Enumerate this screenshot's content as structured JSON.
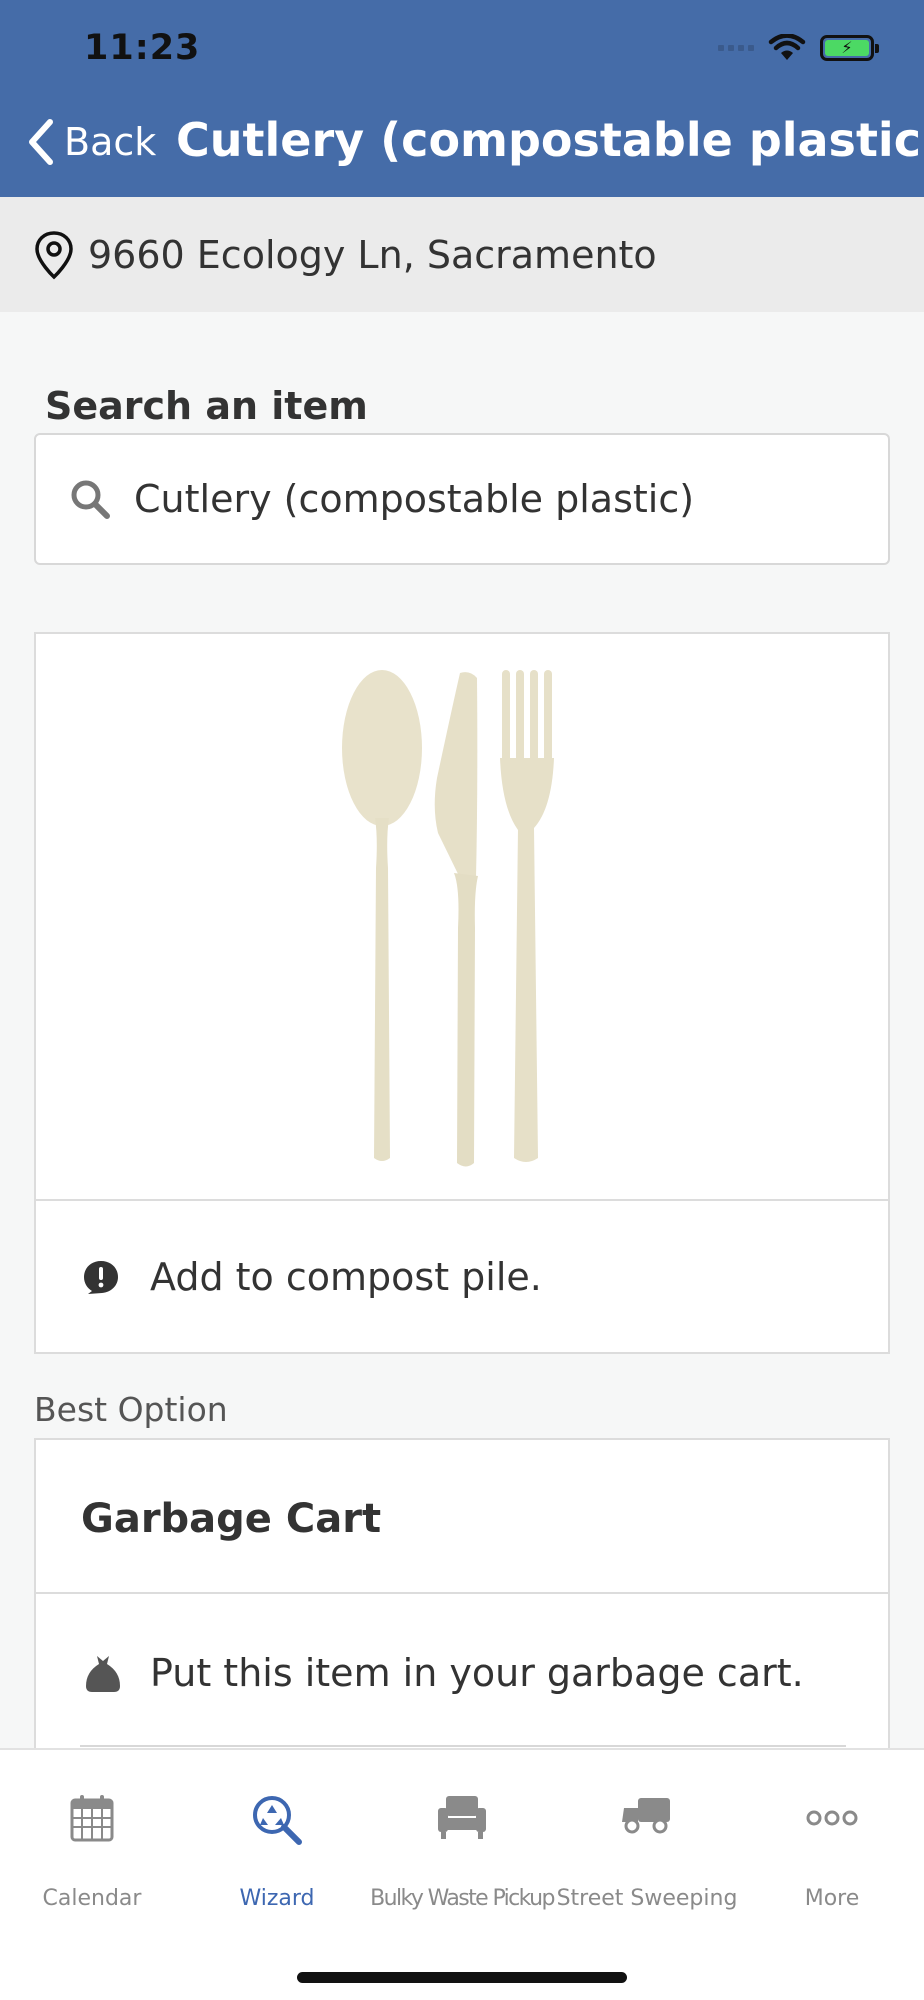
{
  "status_bar": {
    "time": "11:23"
  },
  "nav": {
    "back_label": "Back",
    "title": "Cutlery (compostable plastic)"
  },
  "location": {
    "address": "9660 Ecology Ln, Sacramento"
  },
  "search": {
    "label": "Search an item",
    "value": "Cutlery (compostable plastic)"
  },
  "item": {
    "note": "Add to compost pile."
  },
  "best_option": {
    "section_label": "Best Option",
    "title": "Garbage Cart",
    "instruction": "Put this item in your garbage cart."
  },
  "tabs": [
    {
      "label": "Calendar",
      "icon": "calendar-icon",
      "active": false
    },
    {
      "label": "Wizard",
      "icon": "recycle-search-icon",
      "active": true
    },
    {
      "label": "Bulky Waste Pickup",
      "icon": "couch-icon",
      "active": false
    },
    {
      "label": "Street Sweeping",
      "icon": "sweeper-truck-icon",
      "active": false
    },
    {
      "label": "More",
      "icon": "more-dots-icon",
      "active": false
    }
  ],
  "colors": {
    "header": "#456ca8",
    "accent": "#3d67b1",
    "cutlery": "#e8e2cb"
  }
}
